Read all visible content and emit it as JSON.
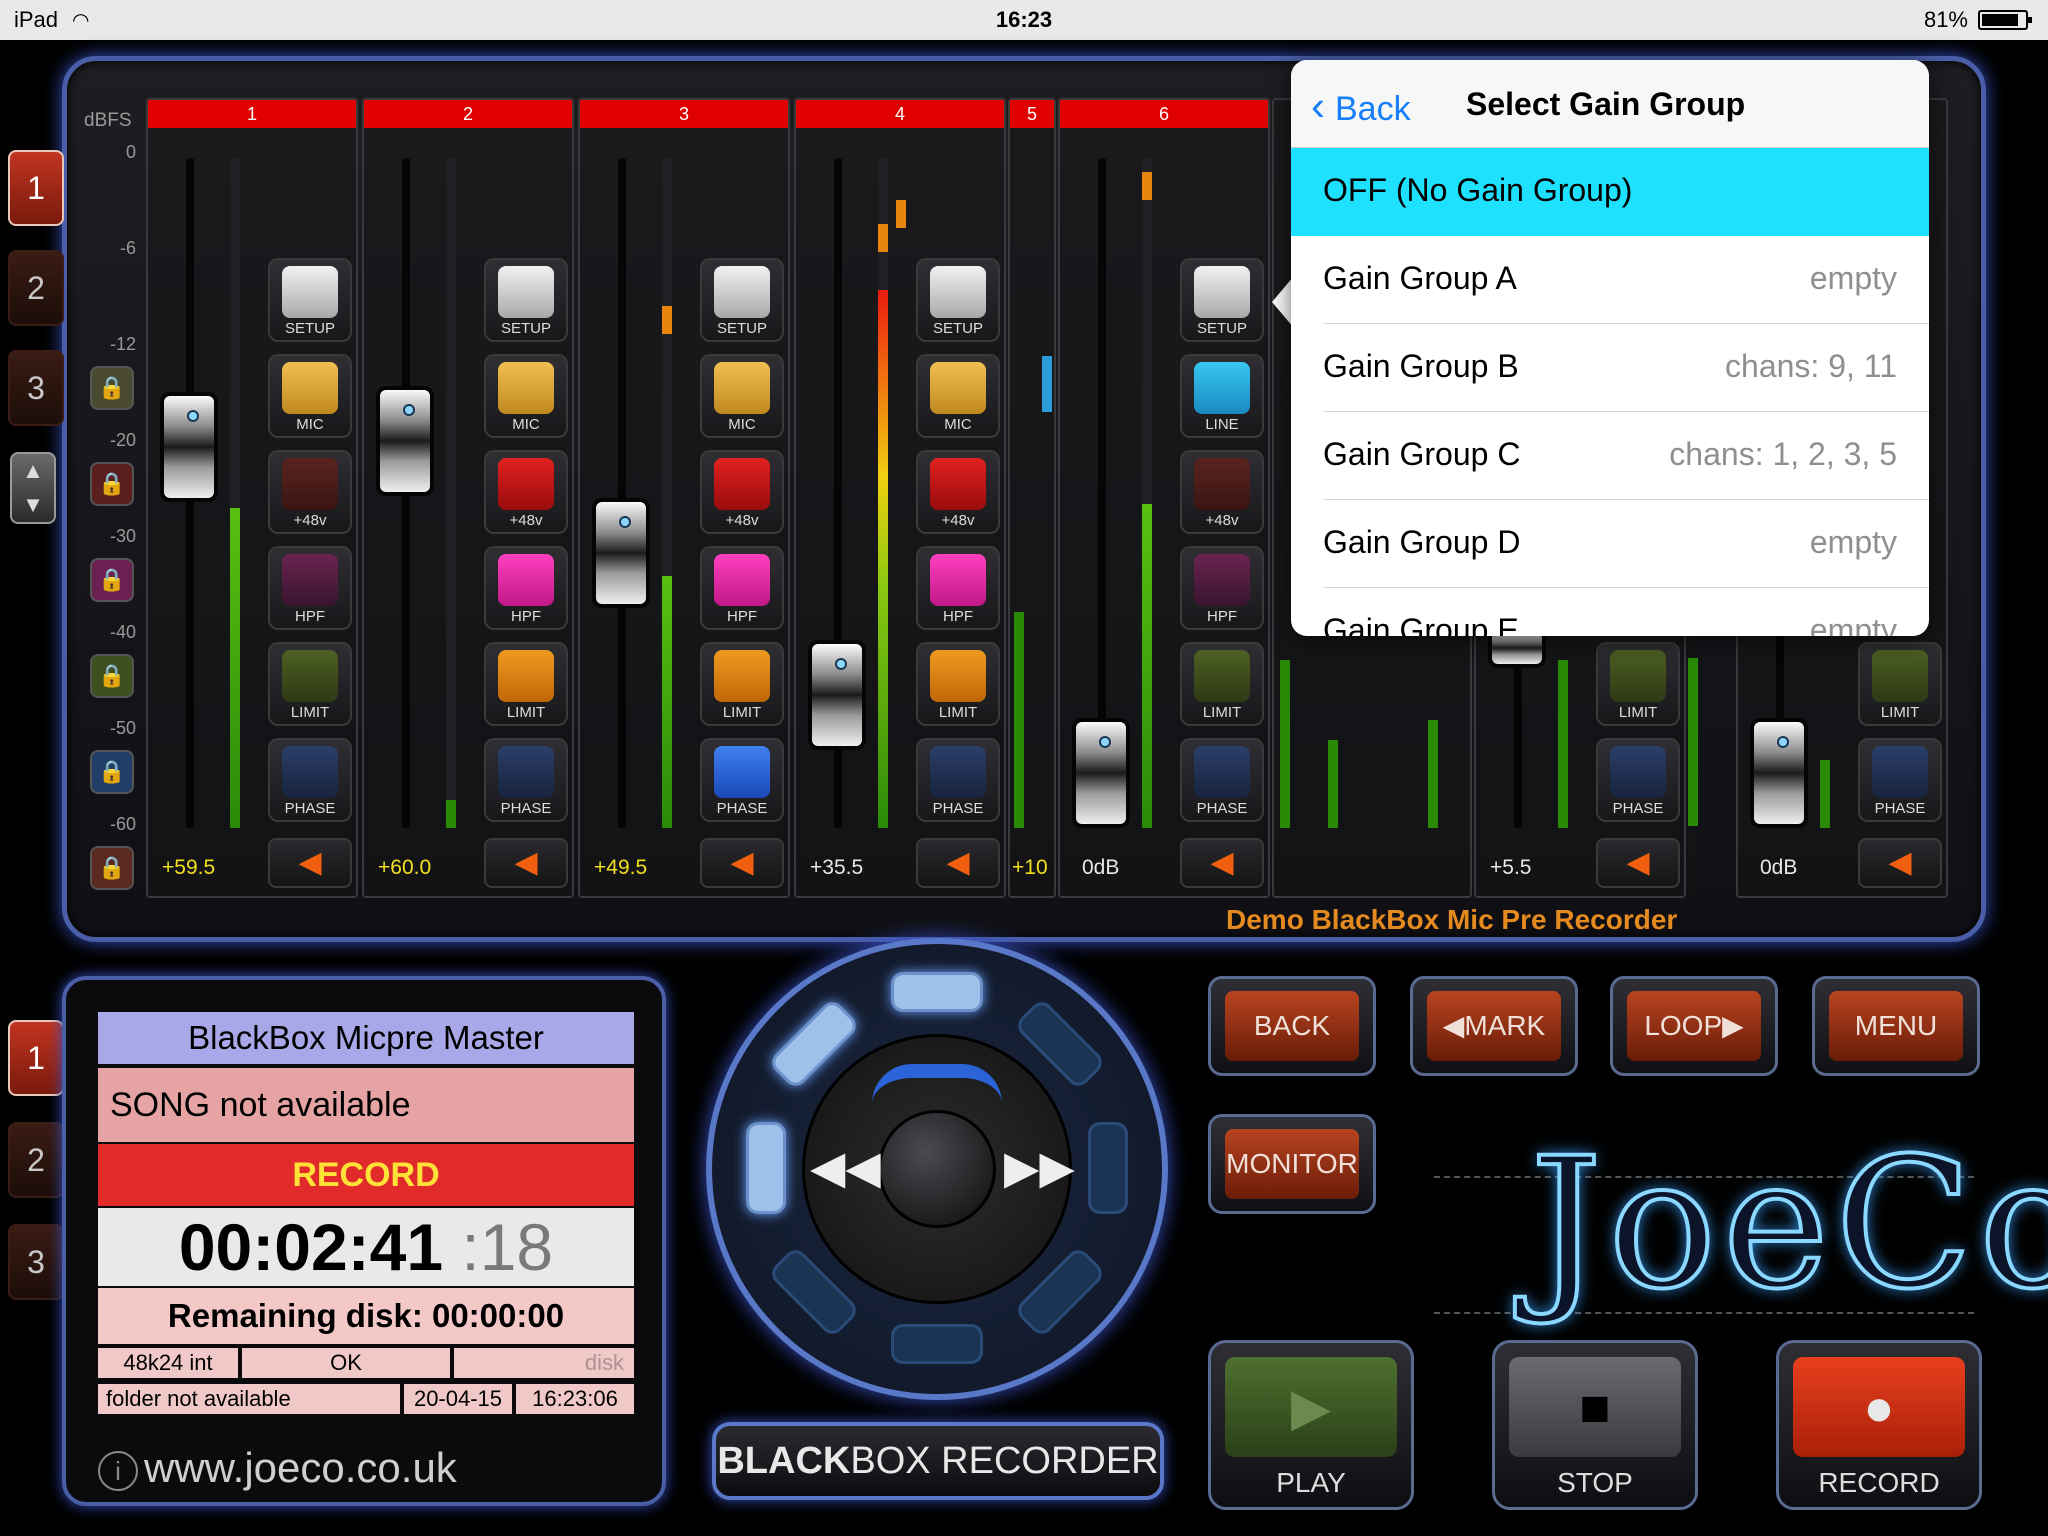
{
  "status_bar": {
    "device": "iPad",
    "time": "16:23",
    "battery": "81%"
  },
  "mixer": {
    "dbfs_label": "dBFS",
    "db_ticks": [
      "0",
      "-6",
      "-12",
      "-20",
      "-30",
      "-40",
      "-50",
      "-60"
    ],
    "bank_buttons": [
      "1",
      "2",
      "3"
    ],
    "strips": [
      {
        "num": "1",
        "gain": "+59.5",
        "mode": "MIC"
      },
      {
        "num": "2",
        "gain": "+60.0",
        "mode": "MIC"
      },
      {
        "num": "3",
        "gain": "+49.5",
        "mode": "MIC"
      },
      {
        "num": "4",
        "gain": "+35.5",
        "mode": "MIC"
      },
      {
        "num": "5",
        "gain": "+10"
      },
      {
        "num": "6",
        "gain": "0dB",
        "mode": "LINE"
      },
      {
        "gain": "+5.5"
      },
      {
        "gain": "0dB"
      }
    ],
    "button_labels": {
      "setup": "SETUP",
      "p48": "+48v",
      "hpf": "HPF",
      "limit": "LIMIT",
      "phase": "PHASE"
    },
    "device_name": "Demo BlackBox Mic Pre Recorder"
  },
  "gain_group_popover": {
    "back": "Back",
    "title": "Select Gain Group",
    "rows": [
      {
        "name": "OFF (No Gain Group)",
        "value": ""
      },
      {
        "name": "Gain Group A",
        "value": "empty"
      },
      {
        "name": "Gain Group B",
        "value": "chans: 9, 11"
      },
      {
        "name": "Gain Group C",
        "value": "chans: 1, 2, 3, 5"
      },
      {
        "name": "Gain Group D",
        "value": "empty"
      },
      {
        "name": "Gain Group E",
        "value": "empty"
      }
    ]
  },
  "recorder_display": {
    "bank_buttons": [
      "1",
      "2",
      "3"
    ],
    "title": "BlackBox Micpre Master",
    "song": "SONG not available",
    "mode": "RECORD",
    "time": "00:02:41",
    "frames": ":18",
    "remaining": "Remaining disk: 00:00:00",
    "format": "48k24 int",
    "status": "OK",
    "disk": "disk",
    "folder": "folder not available",
    "date": "20-04-15",
    "clock": "16:23:06",
    "info_icon": "i",
    "website": "www.joeco.co.uk"
  },
  "jog": {
    "rew": "◀◀",
    "ff": "▶▶"
  },
  "blackbox_button": {
    "bold": "BLACK",
    "normal": "BOX RECORDER"
  },
  "transport": {
    "back": "BACK",
    "mark": "◀MARK",
    "loop": "LOOP▶",
    "menu": "MENU",
    "monitor": "MONITOR",
    "play": "PLAY",
    "stop": "STOP",
    "record": "RECORD"
  },
  "logo": "JoeCo"
}
